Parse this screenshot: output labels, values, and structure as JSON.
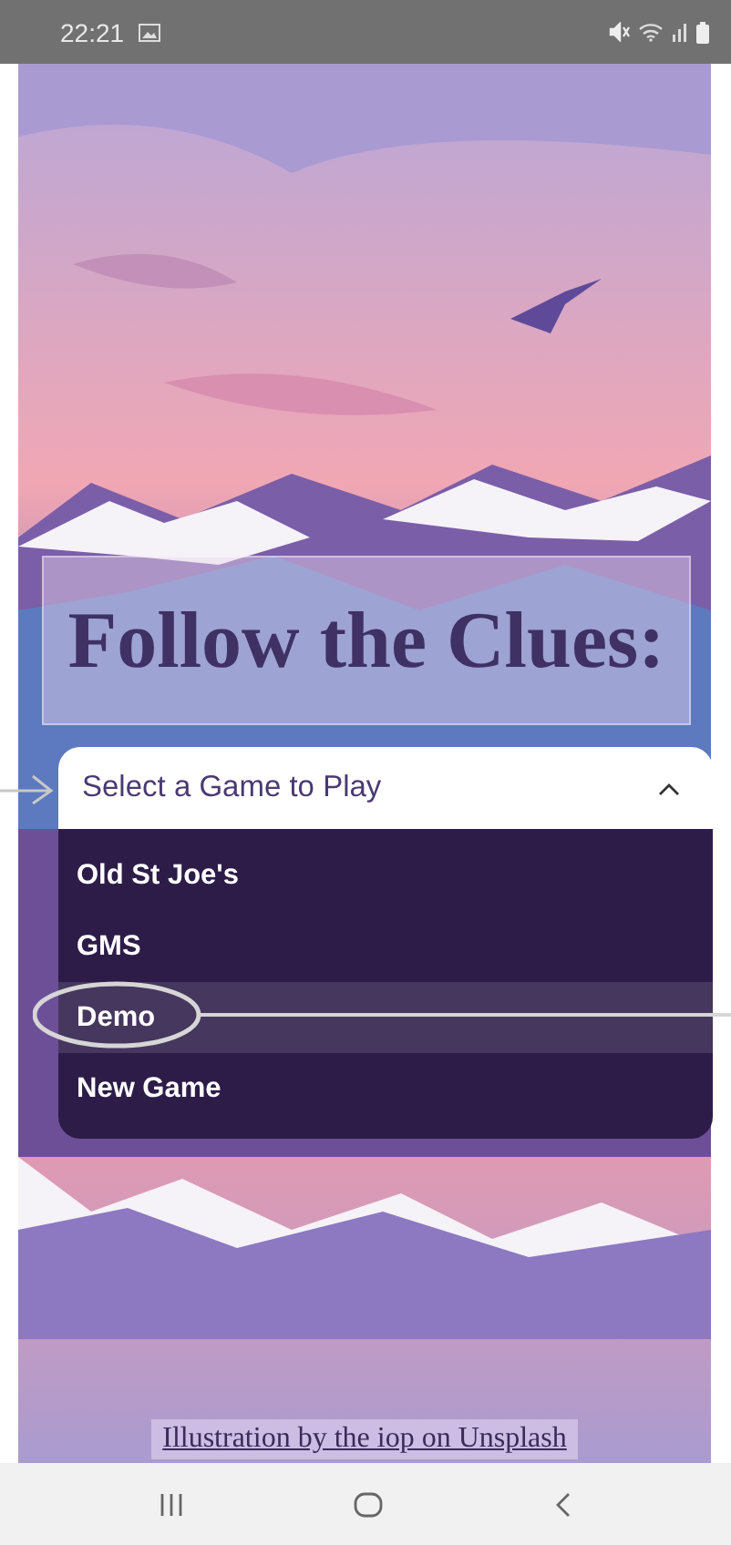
{
  "status_bar": {
    "time": "22:21"
  },
  "title": "Follow the Clues:",
  "dropdown": {
    "placeholder": "Select a Game to Play",
    "expanded": true,
    "options": [
      {
        "label": "Old St Joe's",
        "selected": false
      },
      {
        "label": "GMS",
        "selected": false
      },
      {
        "label": "Demo",
        "selected": true
      },
      {
        "label": "New Game",
        "selected": false
      }
    ]
  },
  "credit": "Illustration by the iop on Unsplash"
}
